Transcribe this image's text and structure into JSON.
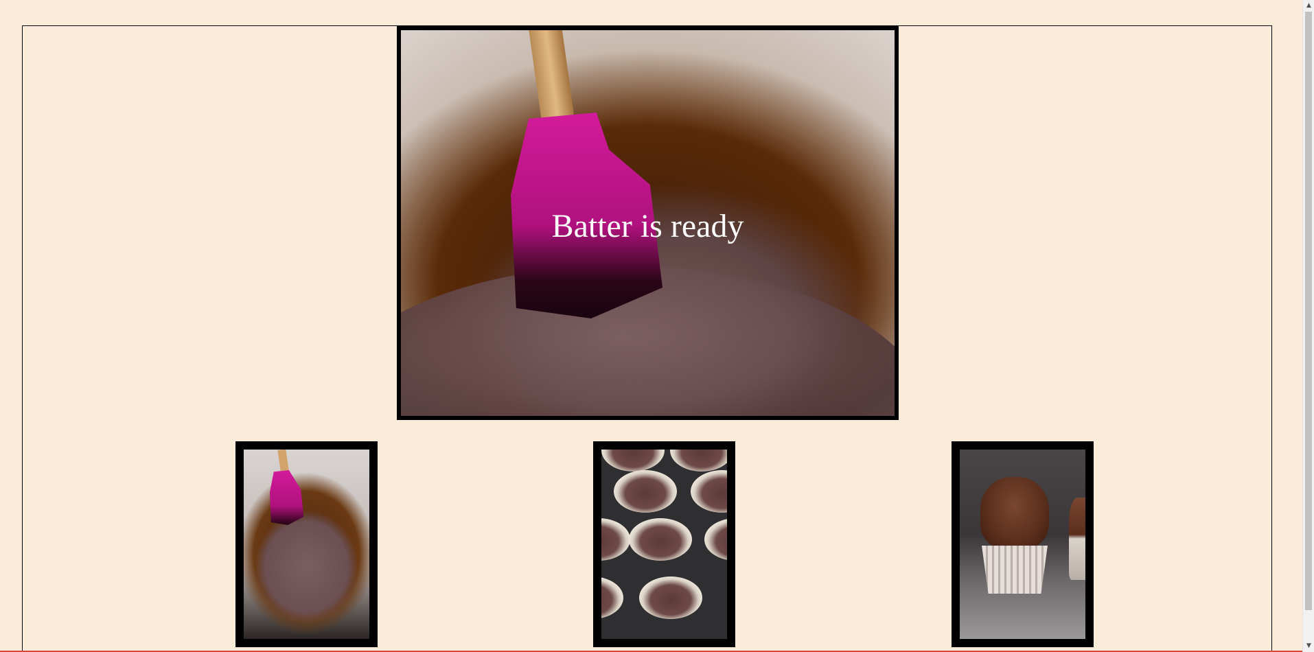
{
  "hero": {
    "caption": "Batter is ready",
    "image_alt": "Chocolate batter in bowl with pink spatula"
  },
  "thumbnails": [
    {
      "alt": "Chocolate batter in bowl"
    },
    {
      "alt": "Muffin tin with cupcake liners filled with batter"
    },
    {
      "alt": "Frosted chocolate cupcake"
    }
  ],
  "colors": {
    "background": "#fbecd9",
    "frame_border": "#000000",
    "caption": "#ffffff",
    "spatula": "#c8168c"
  },
  "scrollbar": {
    "up_icon": "▲",
    "down_icon": "▼"
  }
}
